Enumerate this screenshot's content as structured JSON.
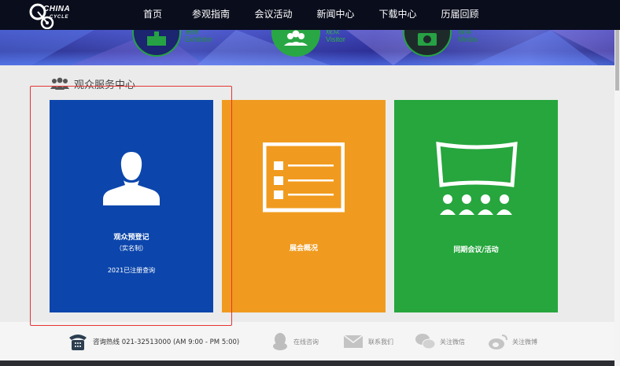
{
  "header": {
    "logo_line1": "CHINA",
    "logo_line2": "CYCLE",
    "nav": [
      "首页",
      "参观指南",
      "会议活动",
      "新闻中心",
      "下载中心",
      "历届回顾"
    ]
  },
  "banner": {
    "left_cn": "展商",
    "left_en": "Exhibitor",
    "mid_cn": "观众",
    "mid_en": "Visitor",
    "right_cn": "媒体",
    "right_en": "Media"
  },
  "section": {
    "title": "观众服务中心"
  },
  "tiles": {
    "visitor": {
      "title": "观众预登记",
      "subtitle": "（实名制）",
      "query": "2021已注册查询",
      "color": "#0c46ac"
    },
    "overview": {
      "title": "展会概况",
      "color": "#f09b1f"
    },
    "events": {
      "title": "同期会议/活动",
      "color": "#26a63d"
    }
  },
  "footer": {
    "hotline": "咨询热线  021-32513000   (AM 9:00 - PM 5:00)",
    "online": "在线咨询",
    "contact": "联系我们",
    "wechat": "关注微信",
    "weibo": "关注微博"
  }
}
